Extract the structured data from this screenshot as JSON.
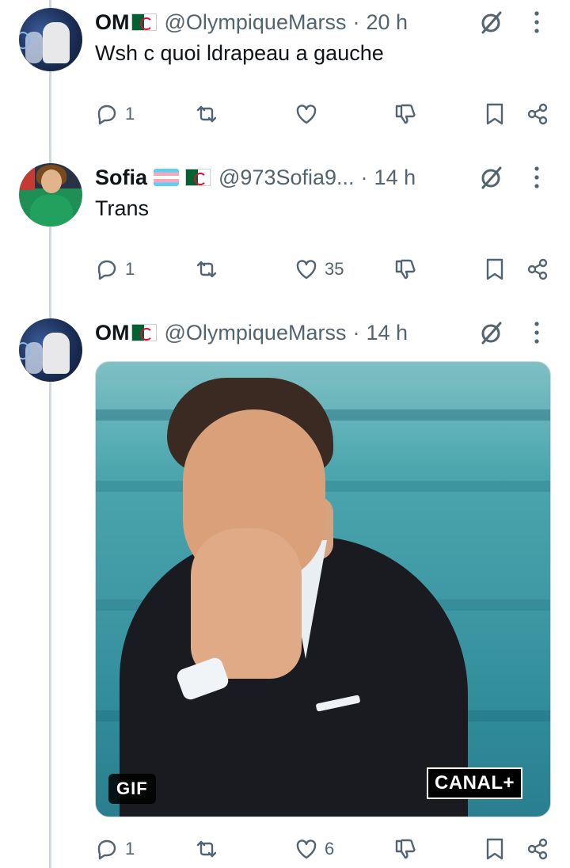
{
  "tweets": [
    {
      "name": "OM",
      "flags": [
        "algeria"
      ],
      "handle": "@OlympiqueMarss",
      "time": "20 h",
      "text": "Wsh c quoi ldrapeau a gauche",
      "replies": "1",
      "retweets": "",
      "likes": ""
    },
    {
      "name": "Sofia",
      "flags": [
        "transgender",
        "algeria"
      ],
      "handle": "@973Sofia9...",
      "time": "14 h",
      "text": "Trans",
      "replies": "1",
      "retweets": "",
      "likes": "35"
    },
    {
      "name": "OM",
      "flags": [
        "algeria"
      ],
      "handle": "@OlympiqueMarss",
      "time": "14 h",
      "text": "",
      "media": {
        "type": "gif",
        "badge": "GIF",
        "watermark": "CANAL+"
      },
      "replies": "1",
      "retweets": "",
      "likes": "6"
    }
  ],
  "separator": "·",
  "icons": [
    "grok-icon",
    "more-icon",
    "reply-icon",
    "retweet-icon",
    "like-icon",
    "dislike-icon",
    "bookmark-icon",
    "share-icon"
  ],
  "colors": {
    "secondary_text": "#536471",
    "thread_line": "#cfd9de",
    "primary_text": "#0f1419"
  }
}
